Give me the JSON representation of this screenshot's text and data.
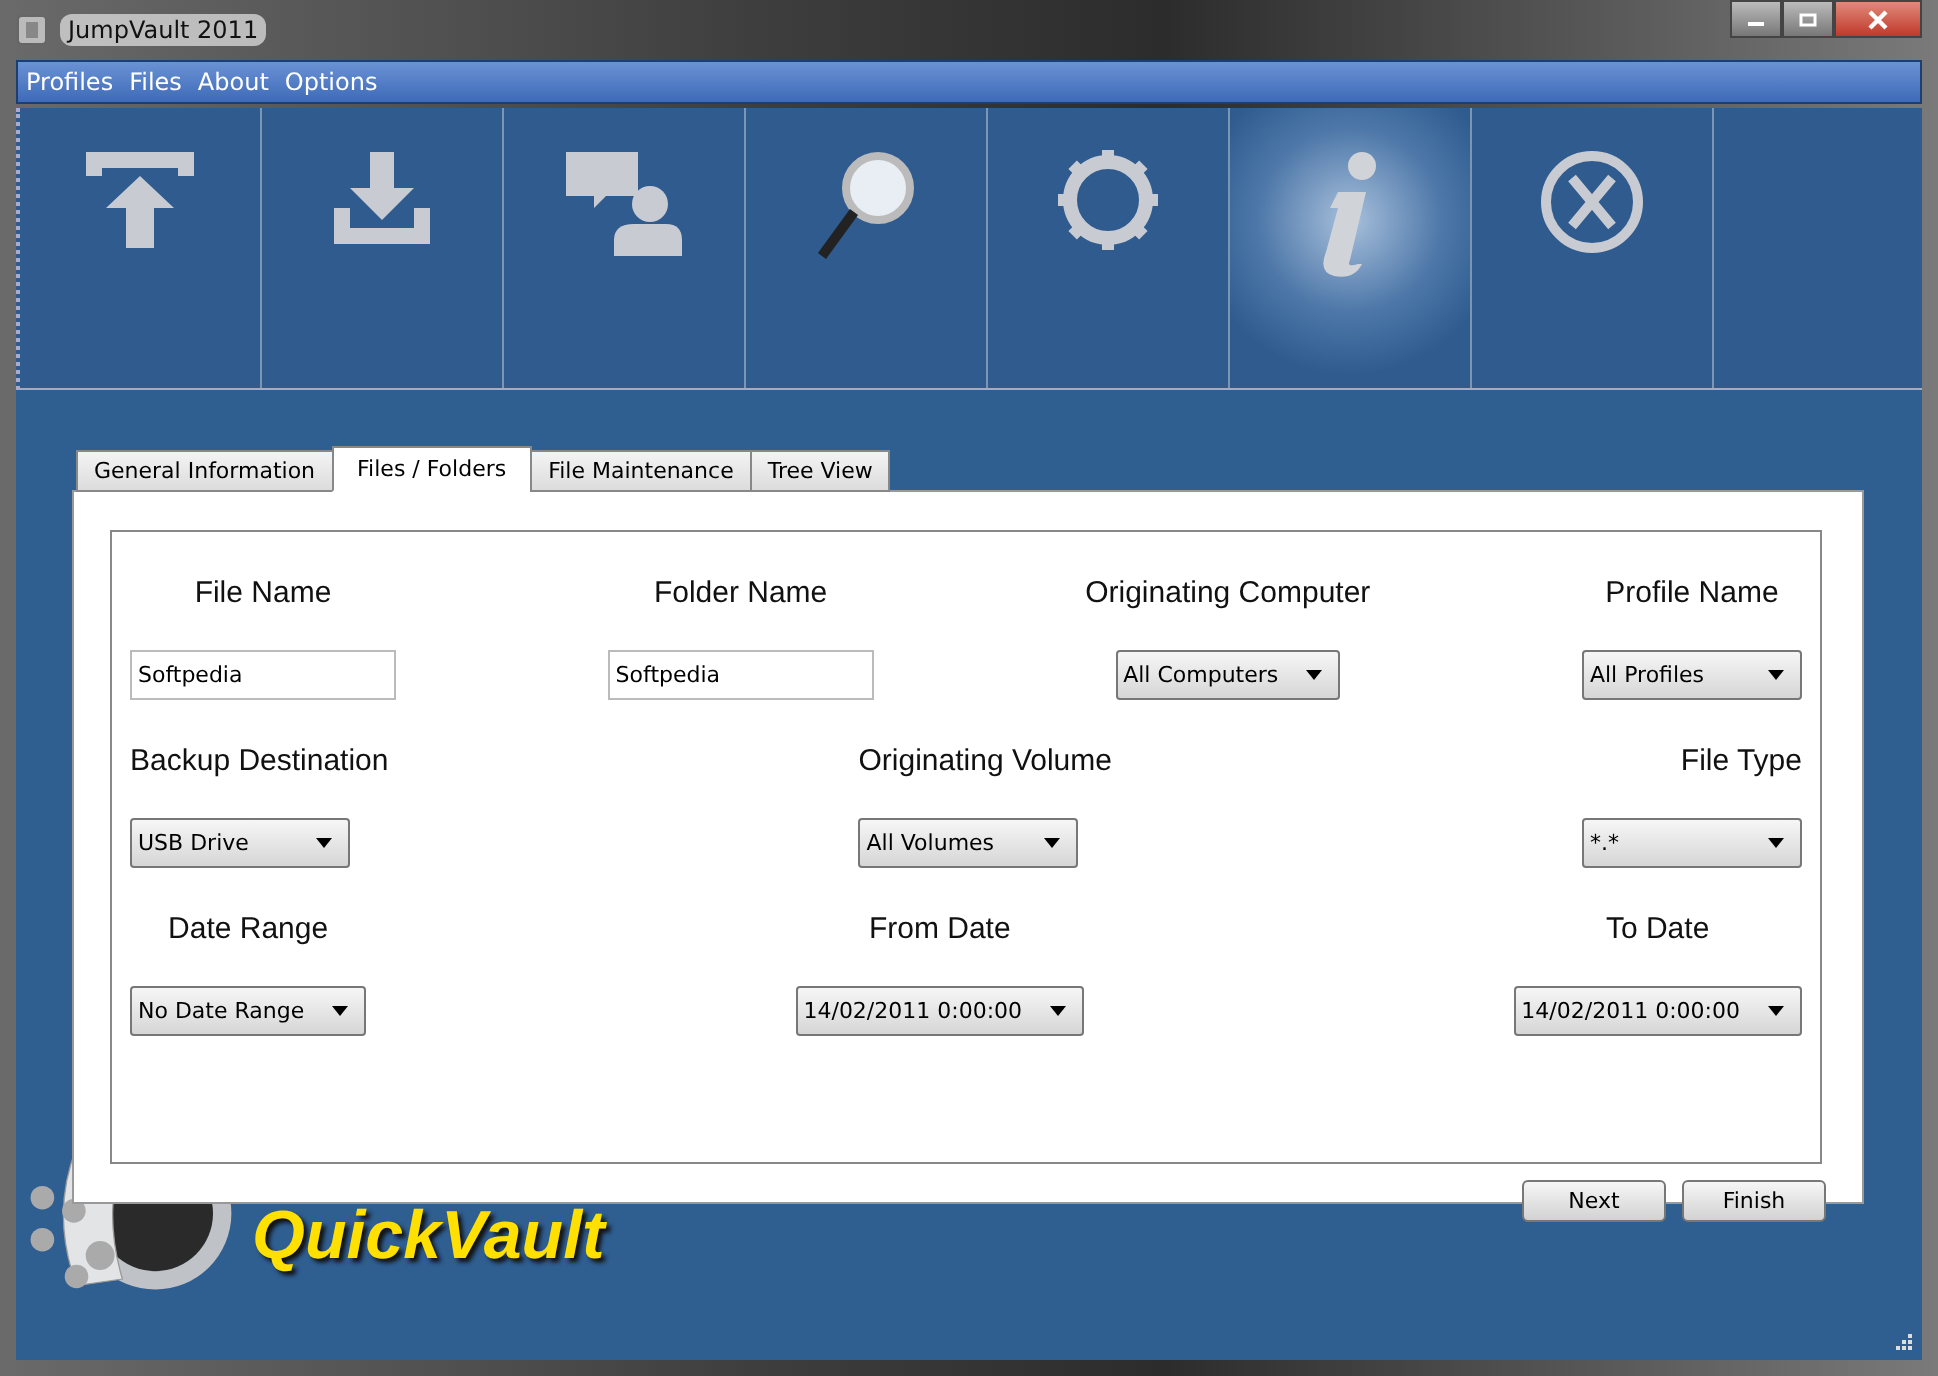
{
  "window": {
    "title": "JumpVault 2011"
  },
  "menu": [
    "Profiles",
    "Files",
    "About",
    "Options"
  ],
  "toolbar": [
    {
      "kind": "upload",
      "selected": false
    },
    {
      "kind": "download",
      "selected": false
    },
    {
      "kind": "chat",
      "selected": false
    },
    {
      "kind": "search",
      "selected": false
    },
    {
      "kind": "gear",
      "selected": false
    },
    {
      "kind": "info",
      "selected": true
    },
    {
      "kind": "close",
      "selected": false
    }
  ],
  "tabs": [
    {
      "label": "General Information",
      "selected": false
    },
    {
      "label": "Files / Folders",
      "selected": true
    },
    {
      "label": "File Maintenance",
      "selected": false
    },
    {
      "label": "Tree View",
      "selected": false
    }
  ],
  "form_rows": [
    [
      {
        "label": "File Name",
        "kind": "text",
        "value": "Softpedia"
      },
      {
        "label": "Folder Name",
        "kind": "text",
        "value": "Softpedia"
      },
      {
        "label": "Originating Computer",
        "kind": "select",
        "value": "All Computers"
      },
      {
        "label": "Profile Name",
        "kind": "select",
        "value": "All Profiles"
      }
    ],
    [
      {
        "label": "Backup Destination",
        "kind": "select",
        "value": "USB Drive"
      },
      {
        "label": "Originating Volume",
        "kind": "select",
        "value": "All Volumes"
      },
      {
        "label": "File Type",
        "kind": "select",
        "value": "*.*"
      }
    ],
    [
      {
        "label": "Date Range",
        "kind": "select",
        "value": "No Date Range"
      },
      {
        "label": "From Date",
        "kind": "select",
        "value": "14/02/2011 0:00:00"
      },
      {
        "label": "To Date",
        "kind": "select",
        "value": "14/02/2011 0:00:00"
      }
    ]
  ],
  "buttons": [
    "Next",
    "Finish"
  ],
  "logo": {
    "text": "QuickVault"
  }
}
